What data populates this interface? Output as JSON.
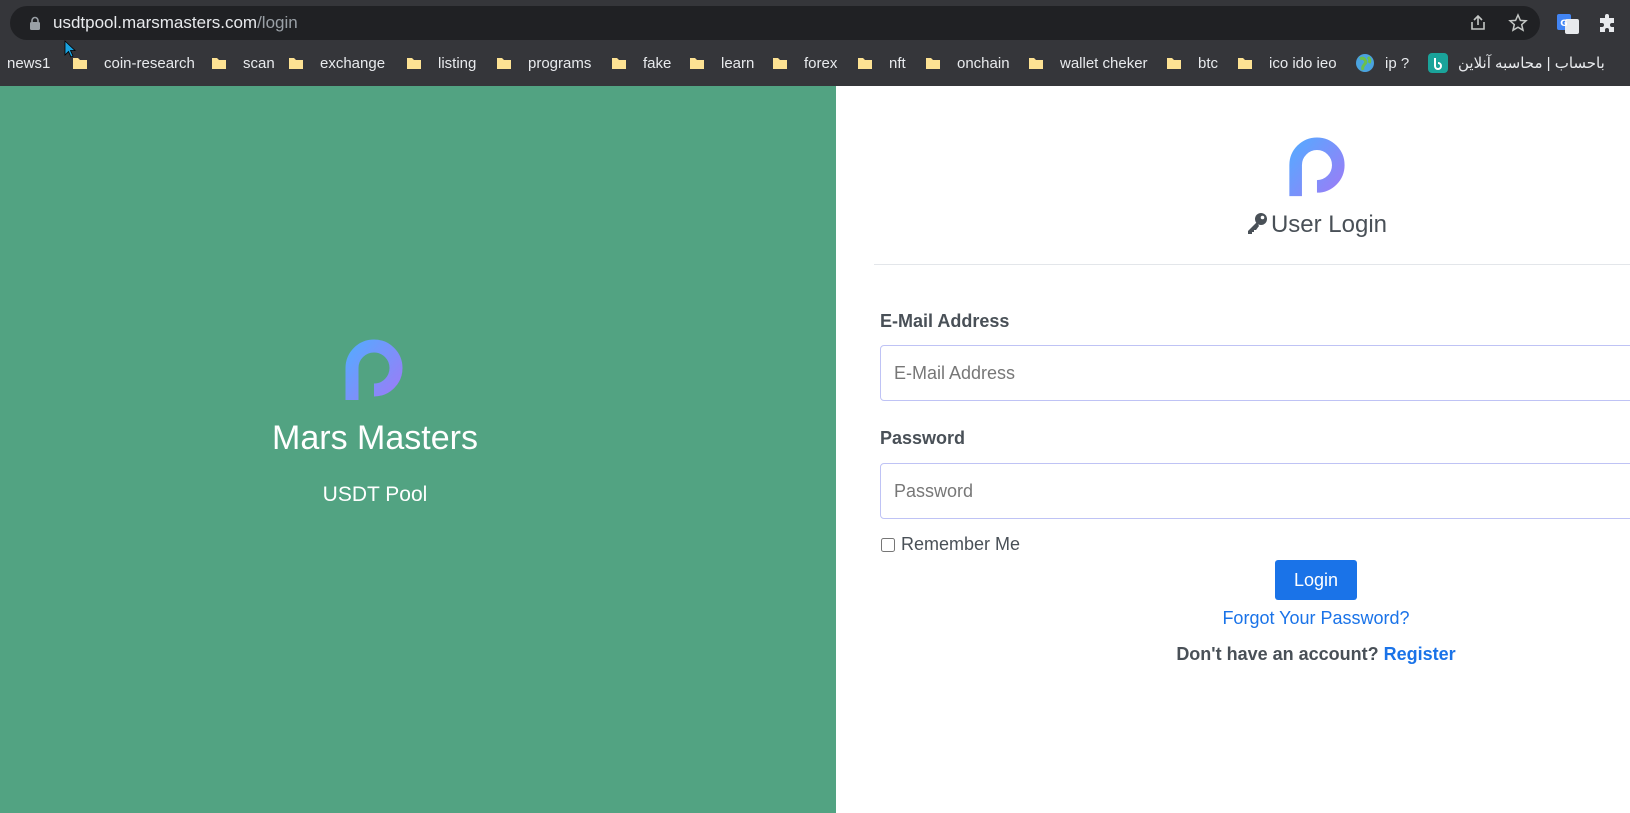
{
  "browser": {
    "url_host": "usdtpool.marsmasters.com",
    "url_path": "/login",
    "bookmarks": [
      {
        "label": "news1",
        "kind": "link"
      },
      {
        "label": "coin-research",
        "kind": "folder"
      },
      {
        "label": "scan",
        "kind": "folder"
      },
      {
        "label": "exchange",
        "kind": "folder"
      },
      {
        "label": "listing",
        "kind": "folder"
      },
      {
        "label": "programs",
        "kind": "folder"
      },
      {
        "label": "fake",
        "kind": "folder"
      },
      {
        "label": "learn",
        "kind": "folder"
      },
      {
        "label": "forex",
        "kind": "folder"
      },
      {
        "label": "nft",
        "kind": "folder"
      },
      {
        "label": "onchain",
        "kind": "folder"
      },
      {
        "label": "wallet cheker",
        "kind": "folder"
      },
      {
        "label": "btc",
        "kind": "folder"
      },
      {
        "label": "ico ido ieo",
        "kind": "folder"
      },
      {
        "label": "ip ?",
        "kind": "globe"
      },
      {
        "label": "باحساب | محاسبه آنلاین",
        "kind": "badge"
      }
    ]
  },
  "brand": {
    "name": "Mars Masters",
    "tagline": "USDT Pool"
  },
  "login": {
    "title": "User Login",
    "email_label": "E-Mail Address",
    "email_placeholder": "E-Mail Address",
    "password_label": "Password",
    "password_placeholder": "Password",
    "remember_label": "Remember Me",
    "submit_label": "Login",
    "forgot_label": "Forgot Your Password?",
    "no_account_text": "Don't have an account?",
    "register_label": "Register"
  },
  "colors": {
    "left_panel": "#52a382",
    "accent": "#1a73e8",
    "chrome": "#35363a"
  }
}
